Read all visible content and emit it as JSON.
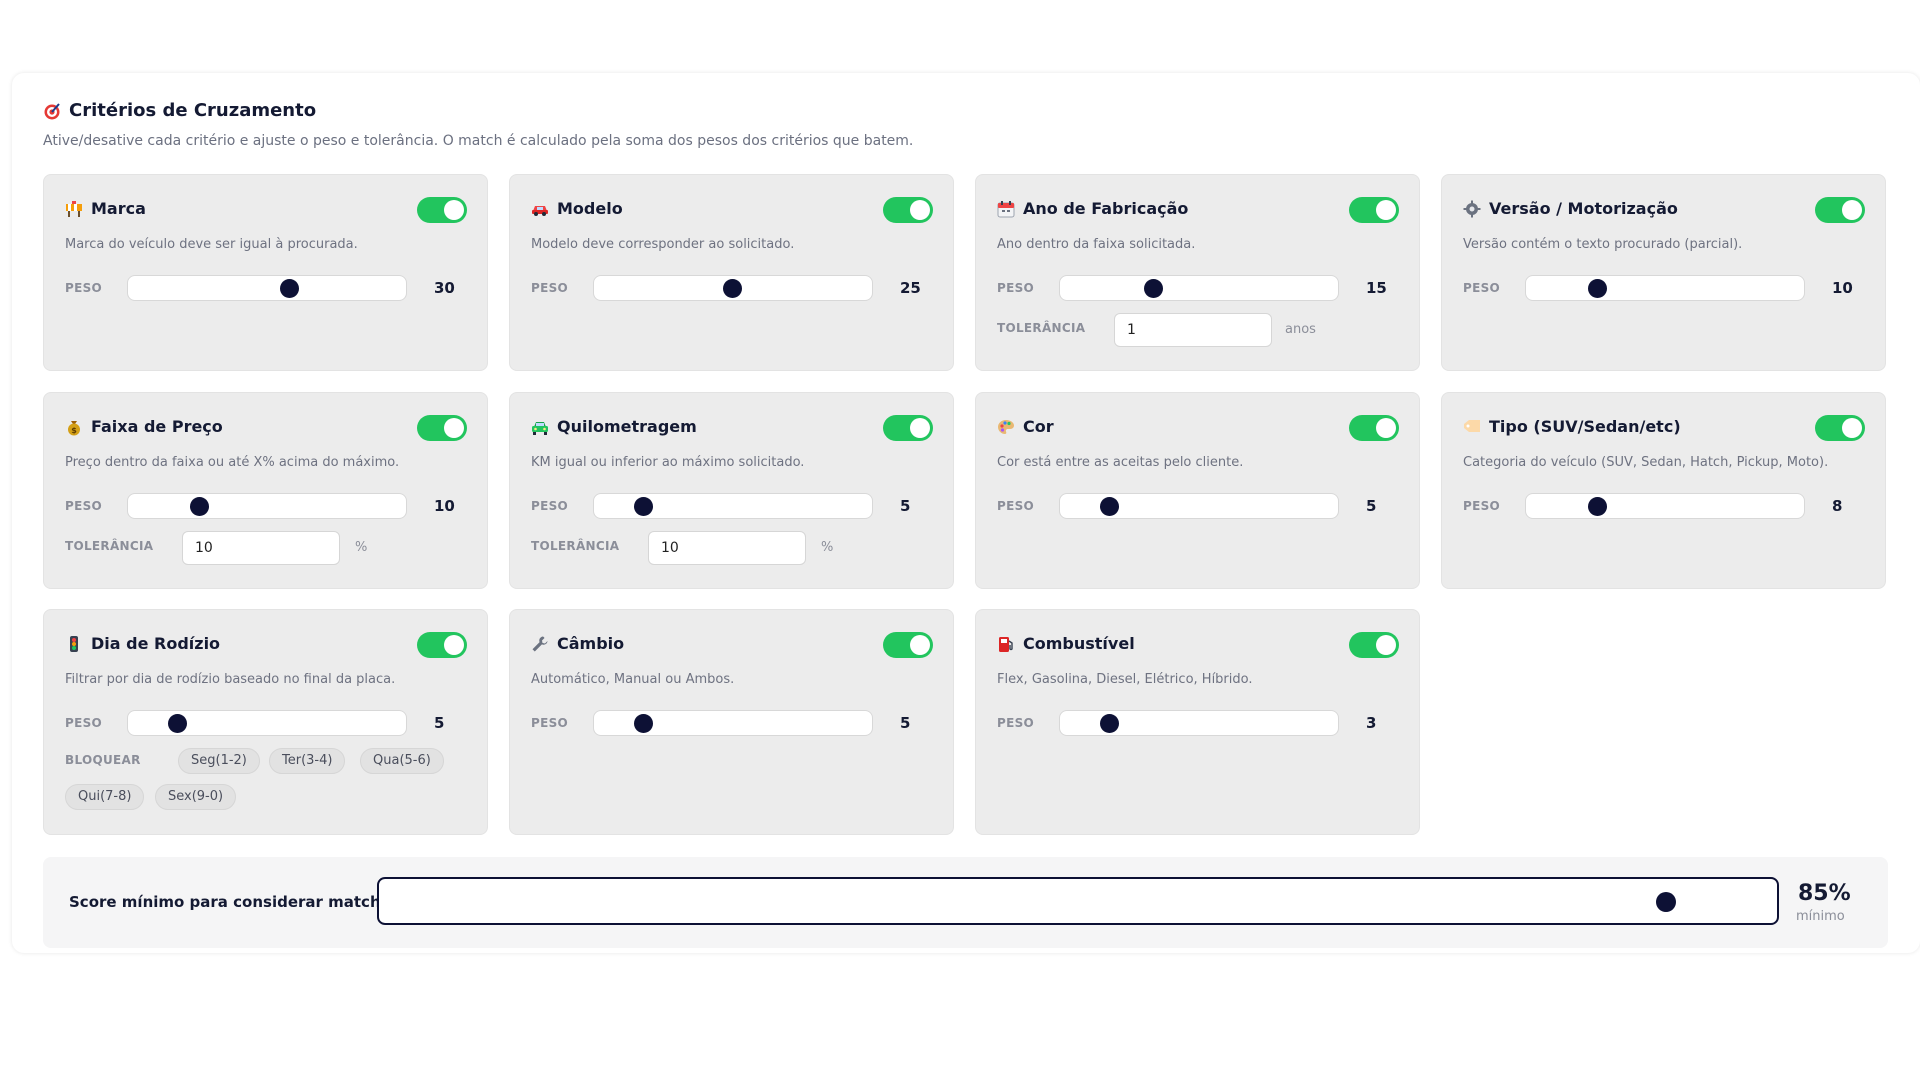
{
  "header": {
    "title": "Critérios de Cruzamento",
    "subtitle": "Ative/desative cada critério e ajuste o peso e tolerância. O match é calculado pela soma dos pesos dos critérios que batem."
  },
  "labels": {
    "weight": "PESO",
    "tolerance": "TOLERÂNCIA",
    "block": "BLOQUEAR"
  },
  "criteria": [
    {
      "title": "Marca",
      "icon": "construction-icon",
      "enabled": true,
      "description": "Marca do veículo deve ser igual à procurada.",
      "weight": 30,
      "weight_display": "30"
    },
    {
      "title": "Modelo",
      "icon": "car-icon",
      "enabled": true,
      "description": "Modelo deve corresponder ao solicitado.",
      "weight": 25,
      "weight_display": "25"
    },
    {
      "title": "Ano de Fabricação",
      "icon": "calendar-icon",
      "enabled": true,
      "description": "Ano dentro da faixa solicitada.",
      "weight": 15,
      "weight_display": "15",
      "tolerance": "1",
      "tolerance_unit": "anos"
    },
    {
      "title": "Versão / Motorização",
      "icon": "gear-icon",
      "enabled": true,
      "description": "Versão contém o texto procurado (parcial).",
      "weight": 10,
      "weight_display": "10"
    },
    {
      "title": "Faixa de Preço",
      "icon": "money-bag-icon",
      "enabled": true,
      "description": "Preço dentro da faixa ou até X% acima do máximo.",
      "weight": 10,
      "weight_display": "10",
      "tolerance": "10",
      "tolerance_unit": "%"
    },
    {
      "title": "Quilometragem",
      "icon": "car-front-icon",
      "enabled": true,
      "description": "KM igual ou inferior ao máximo solicitado.",
      "weight": 5,
      "weight_display": "5",
      "tolerance": "10",
      "tolerance_unit": "%"
    },
    {
      "title": "Cor",
      "icon": "palette-icon",
      "enabled": true,
      "description": "Cor está entre as aceitas pelo cliente.",
      "weight": 5,
      "weight_display": "5"
    },
    {
      "title": "Tipo (SUV/Sedan/etc)",
      "icon": "tag-icon",
      "enabled": true,
      "description": "Categoria do veículo (SUV, Sedan, Hatch, Pickup, Moto).",
      "weight": 8,
      "weight_display": "8"
    },
    {
      "title": "Dia de Rodízio",
      "icon": "traffic-light-icon",
      "enabled": true,
      "description": "Filtrar por dia de rodízio baseado no final da placa.",
      "weight": 5,
      "weight_display": "5",
      "chips": [
        "Seg(1-2)",
        "Ter(3-4)",
        "Qua(5-6)",
        "Qui(7-8)",
        "Sex(9-0)"
      ]
    },
    {
      "title": "Câmbio",
      "icon": "wrench-icon",
      "enabled": true,
      "description": "Automático, Manual ou Ambos.",
      "weight": 5,
      "weight_display": "5"
    },
    {
      "title": "Combustível",
      "icon": "fuel-pump-icon",
      "enabled": true,
      "description": "Flex, Gasolina, Diesel, Elétrico, Híbrido.",
      "weight": 3,
      "weight_display": "3"
    }
  ],
  "score": {
    "label": "Score mínimo para considerar match:",
    "value": 85,
    "value_display": "85%",
    "sub": "mínimo"
  },
  "colors": {
    "toggle_on": "#22c55e",
    "accent": "#0d1135",
    "card_bg": "#ececec"
  }
}
